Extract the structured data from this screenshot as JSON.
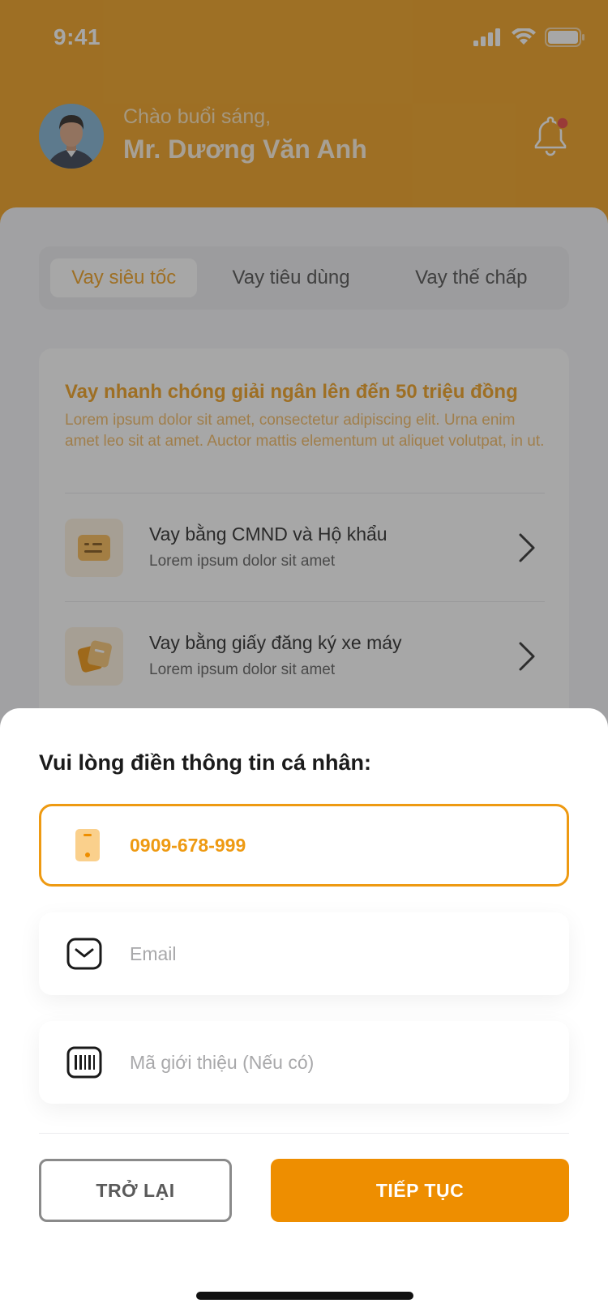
{
  "status_bar": {
    "time": "9:41"
  },
  "header": {
    "greeting": "Chào buổi sáng,",
    "user_name": "Mr. Dương Văn Anh"
  },
  "tabs": [
    {
      "label": "Vay siêu tốc",
      "active": true
    },
    {
      "label": "Vay tiêu dùng",
      "active": false
    },
    {
      "label": "Vay thế chấp",
      "active": false
    }
  ],
  "card": {
    "title": "Vay nhanh chóng giải ngân lên đến 50 triệu đồng",
    "description": "Lorem ipsum dolor sit amet, consectetur adipiscing elit. Urna enim amet leo sit at amet. Auctor mattis elementum ut aliquet volutpat, in ut.",
    "options": [
      {
        "title": "Vay bằng CMND và Hộ khẩu",
        "subtitle": "Lorem ipsum dolor sit amet",
        "icon": "id-card-icon"
      },
      {
        "title": "Vay bằng giấy đăng ký xe máy",
        "subtitle": "Lorem ipsum dolor sit amet",
        "icon": "documents-icon"
      }
    ]
  },
  "sheet": {
    "title": "Vui lòng điền thông tin cá nhân:",
    "phone": {
      "value": "0909-678-999",
      "icon": "phone-icon"
    },
    "email": {
      "value": "",
      "placeholder": "Email",
      "icon": "mail-icon"
    },
    "referral": {
      "value": "",
      "placeholder": "Mã giới thiệu (Nếu có)",
      "icon": "barcode-icon"
    },
    "back_label": "TRỞ LẠI",
    "next_label": "TIẾP TỤC"
  },
  "colors": {
    "primary": "#EE9A12",
    "button": "#EE8E00",
    "notification_dot": "#E53935"
  }
}
